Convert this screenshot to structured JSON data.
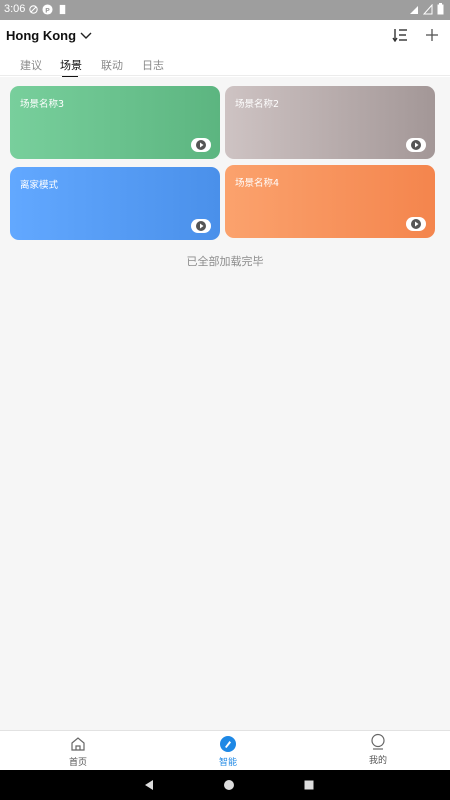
{
  "status_bar": {
    "time": "3:06"
  },
  "header": {
    "location": "Hong Kong",
    "icons": [
      "chevron-down-icon",
      "sort-icon",
      "plus-icon"
    ]
  },
  "tabs": [
    {
      "label": "建议",
      "active": false
    },
    {
      "label": "场景",
      "active": true
    },
    {
      "label": "联动",
      "active": false
    },
    {
      "label": "日志",
      "active": false
    }
  ],
  "scenes": [
    {
      "name": "场景名称3",
      "color_from": "#78cf9c",
      "color_to": "#5cb580"
    },
    {
      "name": "场景名称2",
      "color_from": "#cec3c3",
      "color_to": "#a39797"
    },
    {
      "name": "离家模式",
      "color_from": "#62a8ff",
      "color_to": "#4a90ea"
    },
    {
      "name": "场景名称4",
      "color_from": "#fba26d",
      "color_to": "#f4854d"
    }
  ],
  "list_footer": "已全部加载完毕",
  "bottom_nav": [
    {
      "label": "首页",
      "icon": "home-icon",
      "active": false
    },
    {
      "label": "智能",
      "icon": "smart-icon",
      "active": true
    },
    {
      "label": "我的",
      "icon": "profile-icon",
      "active": false
    }
  ],
  "colors": {
    "accent": "#1e88e5",
    "status_bar": "#9e9e9e",
    "content_bg": "#f6f6f6"
  }
}
